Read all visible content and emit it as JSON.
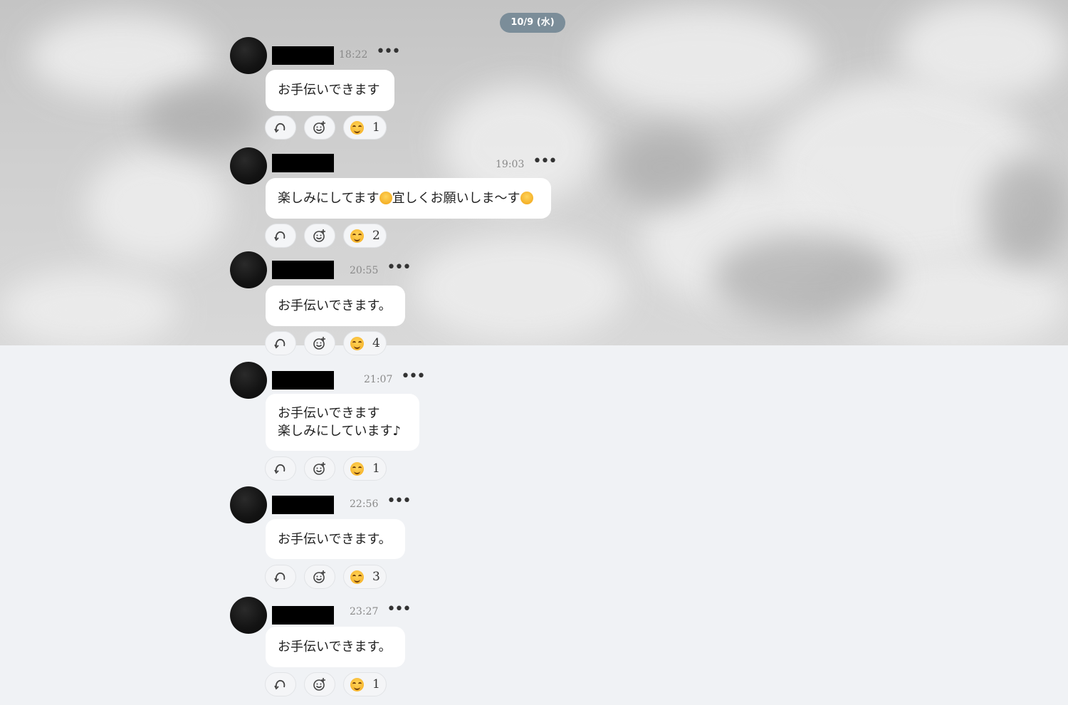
{
  "date_pill": "10/9 (水)",
  "messages": [
    {
      "time": "18:22",
      "text": "お手伝いできます",
      "reaction_count": "1"
    },
    {
      "time": "19:03",
      "text": "楽しみにしてます",
      "text_mid": "宜しくお願いしま〜す",
      "reaction_count": "2"
    },
    {
      "time": "20:55",
      "text": "お手伝いできます。",
      "reaction_count": "4"
    },
    {
      "time": "21:07",
      "text": "お手伝いできます\n楽しみにしています♪",
      "reaction_count": "1"
    },
    {
      "time": "22:56",
      "text": "お手伝いできます。",
      "reaction_count": "3"
    },
    {
      "time": "23:27",
      "text": "お手伝いできます。",
      "reaction_count": "1"
    }
  ],
  "icons": {
    "more": "more-options-icon",
    "reply": "reply-icon",
    "add_reaction": "add-reaction-icon",
    "reaction": "smiling-face-emoji"
  },
  "colors": {
    "date_pill_bg": "#7b8d99",
    "bubble_bg": "#ffffff",
    "page_bg": "#f0f2f5",
    "redaction": "#000000"
  }
}
